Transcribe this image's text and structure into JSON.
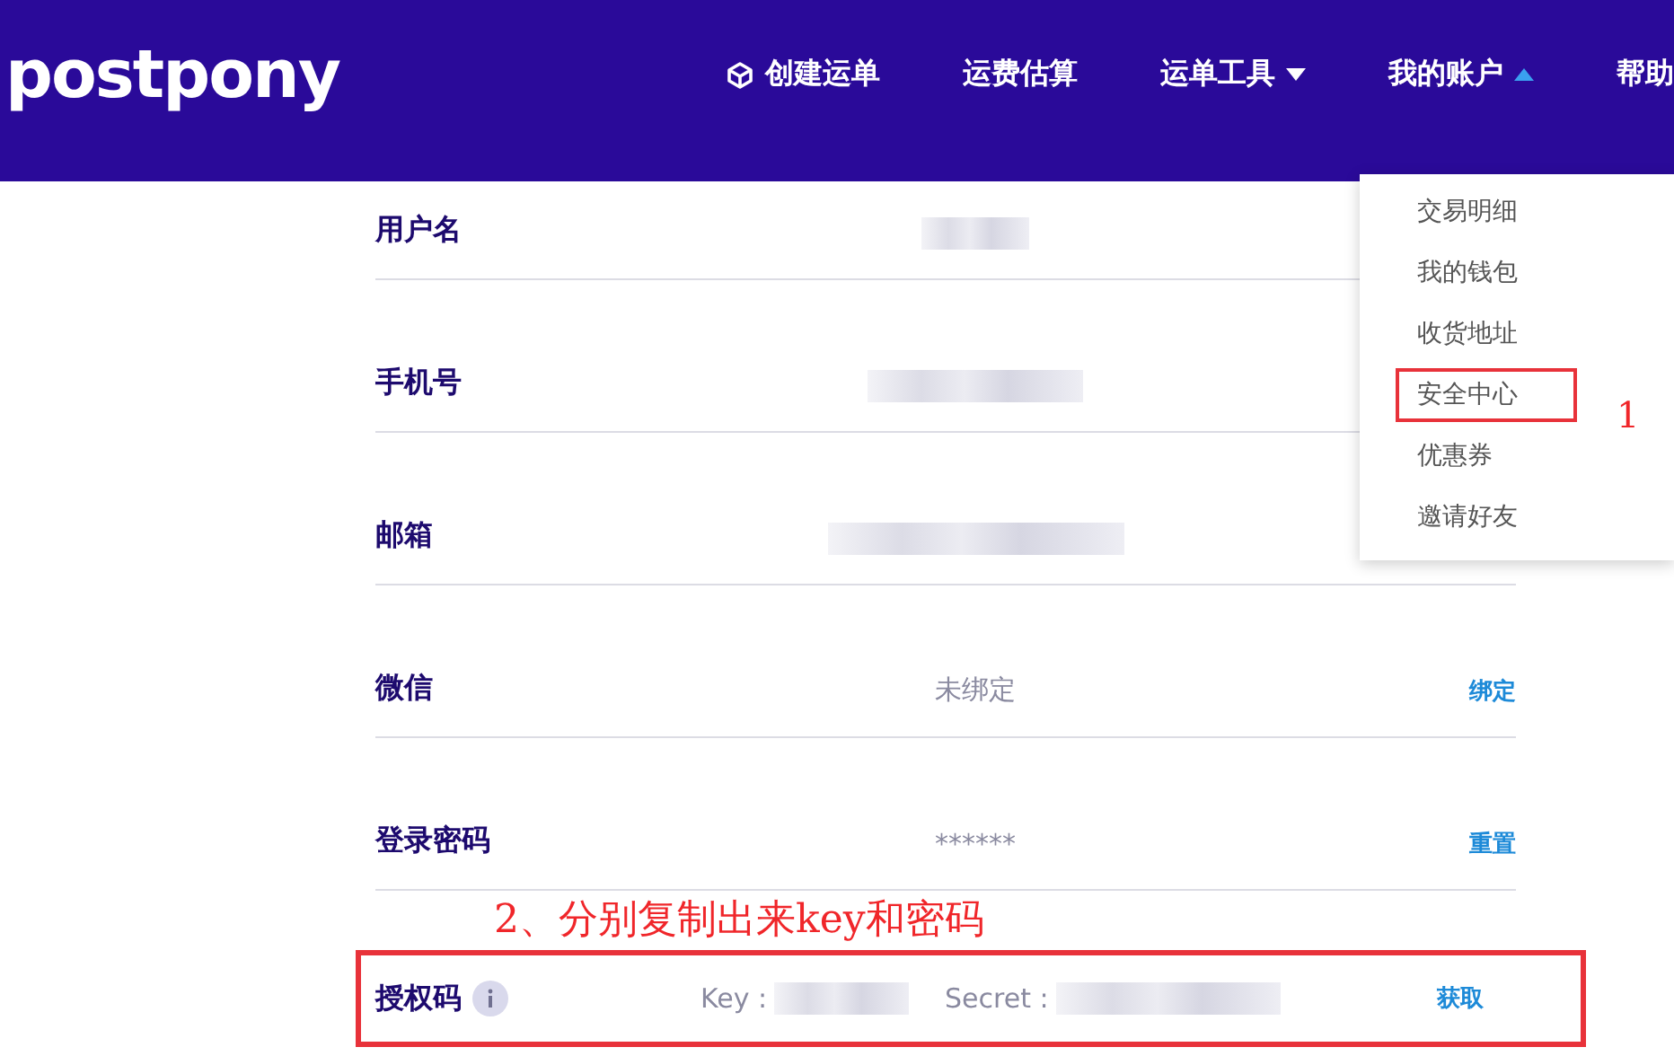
{
  "header": {
    "logo": "postpony",
    "nav": [
      {
        "label": "创建运单",
        "kind": "icon"
      },
      {
        "label": "运费估算",
        "kind": "plain"
      },
      {
        "label": "运单工具",
        "kind": "caret-down"
      },
      {
        "label": "我的账户",
        "kind": "caret-up"
      },
      {
        "label": "帮助",
        "kind": "plain"
      }
    ]
  },
  "account_menu": [
    {
      "label": "交易明细",
      "selected": false
    },
    {
      "label": "我的钱包",
      "selected": false
    },
    {
      "label": "收货地址",
      "selected": false
    },
    {
      "label": "安全中心",
      "selected": true
    },
    {
      "label": "优惠券",
      "selected": false
    },
    {
      "label": "邀请好友",
      "selected": false
    }
  ],
  "step_1": "1",
  "rows": [
    {
      "kind": "plain",
      "label": "用户名",
      "redacted": true
    },
    {
      "kind": "plain",
      "label": "手机号",
      "redacted": true
    },
    {
      "kind": "plain",
      "label": "邮箱",
      "redacted": true
    },
    {
      "kind": "plain",
      "label": "微信",
      "value": "未绑定",
      "action": "绑定"
    },
    {
      "kind": "plain",
      "label": "登录密码",
      "value": "******",
      "action": "重置"
    },
    {
      "kind": "auth",
      "label": "授权码",
      "key_label": "Key :",
      "secret_label": "Secret :",
      "action": "获取",
      "highlighted": true
    }
  ],
  "step_2": "2、分别复制出来key和密码"
}
